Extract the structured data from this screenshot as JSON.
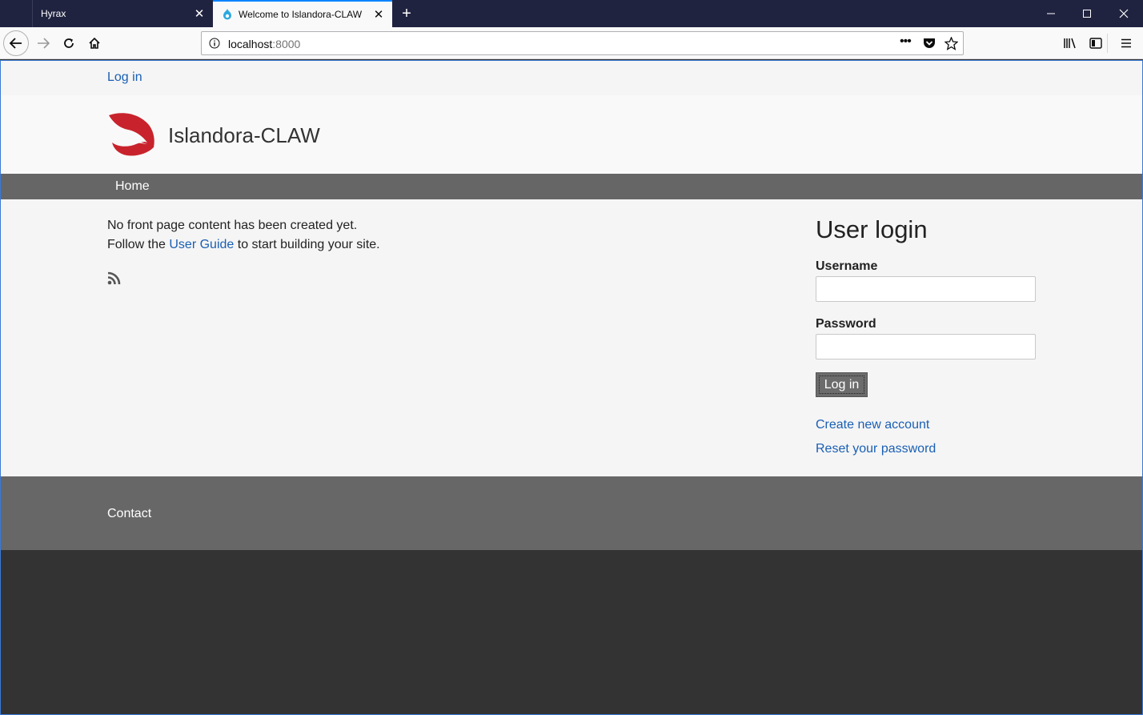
{
  "browser": {
    "tabs": [
      {
        "title": "Hyrax",
        "active": false
      },
      {
        "title": "Welcome to Islandora-CLAW | I",
        "active": true
      }
    ],
    "url": {
      "host": "localhost",
      "port": ":8000"
    }
  },
  "page": {
    "top_login_link": "Log in",
    "site_name": "Islandora-CLAW",
    "nav": {
      "home": "Home"
    },
    "content": {
      "line1": "No front page content has been created yet.",
      "line2_prefix": "Follow the ",
      "line2_link": "User Guide",
      "line2_suffix": " to start building your site."
    },
    "login": {
      "title": "User login",
      "username_label": "Username",
      "password_label": "Password",
      "button": "Log in",
      "create_account": "Create new account",
      "reset_password": "Reset your password"
    },
    "footer": {
      "contact": "Contact"
    }
  },
  "colors": {
    "accent_link": "#1a5fb4",
    "logo_red": "#c8232c",
    "nav_bg": "#666666",
    "footer_bg": "#676767"
  }
}
